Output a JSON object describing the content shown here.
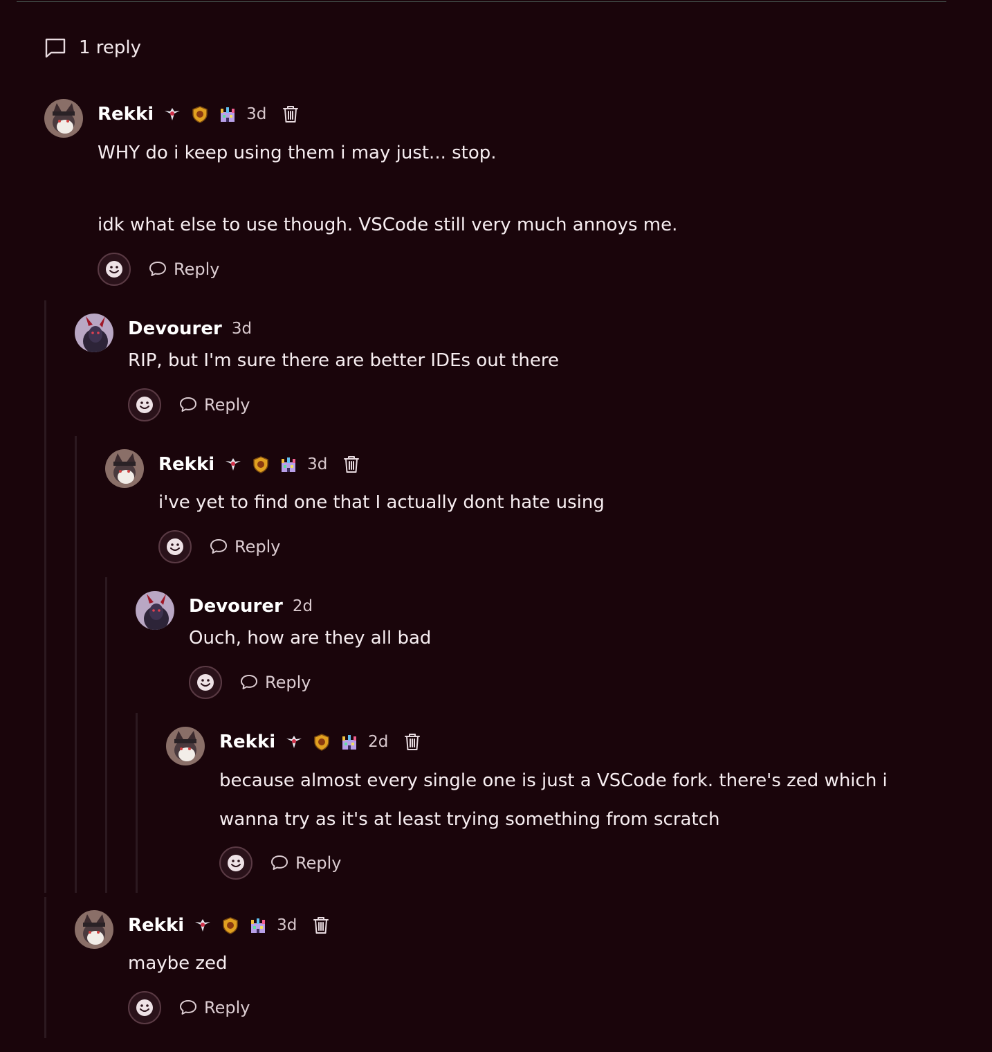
{
  "thread": {
    "reply_count_label": "1 reply"
  },
  "comments": [
    {
      "author": "Rekki",
      "time": "3d",
      "badges": [
        "winged-emblem-badge",
        "shield-badge",
        "rainbow-castle-badge"
      ],
      "lines": [
        "WHY do i keep using them i may just... stop.",
        "",
        "idk what else to use though. VSCode still very much annoys me."
      ],
      "reply_label": "Reply"
    },
    {
      "author": "Devourer",
      "time": "3d",
      "lines": [
        "RIP, but I'm sure there are better IDEs out there"
      ],
      "reply_label": "Reply"
    },
    {
      "author": "Rekki",
      "time": "3d",
      "badges": [
        "winged-emblem-badge",
        "shield-badge",
        "rainbow-castle-badge"
      ],
      "lines": [
        "i've yet to find one that I actually dont hate using"
      ],
      "reply_label": "Reply"
    },
    {
      "author": "Devourer",
      "time": "2d",
      "lines": [
        "Ouch, how are they all bad"
      ],
      "reply_label": "Reply"
    },
    {
      "author": "Rekki",
      "time": "2d",
      "badges": [
        "winged-emblem-badge",
        "shield-badge",
        "rainbow-castle-badge"
      ],
      "lines": [
        "because almost every single one is just a VSCode fork. there's zed which i",
        "wanna try as it's at least trying something from scratch"
      ],
      "reply_label": "Reply"
    },
    {
      "author": "Rekki",
      "time": "3d",
      "badges": [
        "winged-emblem-badge",
        "shield-badge",
        "rainbow-castle-badge"
      ],
      "lines": [
        "maybe zed"
      ],
      "reply_label": "Reply"
    }
  ],
  "colors": {
    "background": "#1a050b",
    "text": "#f7eef1",
    "muted": "#d9c9ce",
    "thread_line": "#2c1920"
  }
}
